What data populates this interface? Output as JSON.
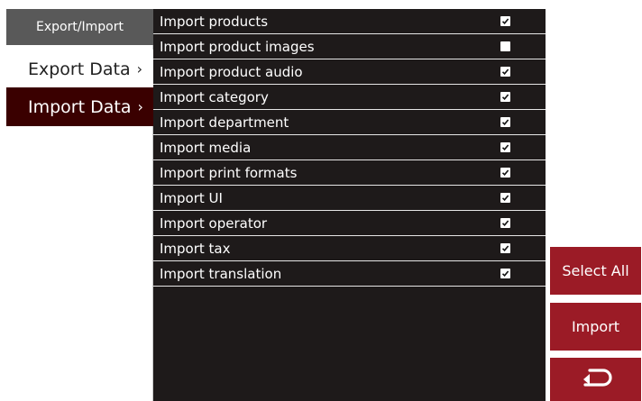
{
  "sidebar": {
    "header": "Export/Import",
    "items": [
      {
        "label": "Export Data",
        "chevron": "›"
      },
      {
        "label": "Import Data",
        "chevron": "›"
      }
    ]
  },
  "import_list": {
    "rows": [
      {
        "label": "Import products",
        "checked": true
      },
      {
        "label": "Import product images",
        "checked": false
      },
      {
        "label": "Import product audio",
        "checked": true
      },
      {
        "label": "Import category",
        "checked": true
      },
      {
        "label": "Import department",
        "checked": true
      },
      {
        "label": "Import media",
        "checked": true
      },
      {
        "label": "Import print formats",
        "checked": true
      },
      {
        "label": "Import UI",
        "checked": true
      },
      {
        "label": "Import operator",
        "checked": true
      },
      {
        "label": "Import tax",
        "checked": true
      },
      {
        "label": "Import translation",
        "checked": true
      }
    ]
  },
  "actions": {
    "select_all_label": "Select All",
    "import_label": "Import",
    "back_icon": "return-arrow-icon"
  },
  "colors": {
    "sidebar_header": "#595959",
    "active_item": "#3a0000",
    "panel": "#1e1a1a",
    "button": "#9b1b26"
  }
}
